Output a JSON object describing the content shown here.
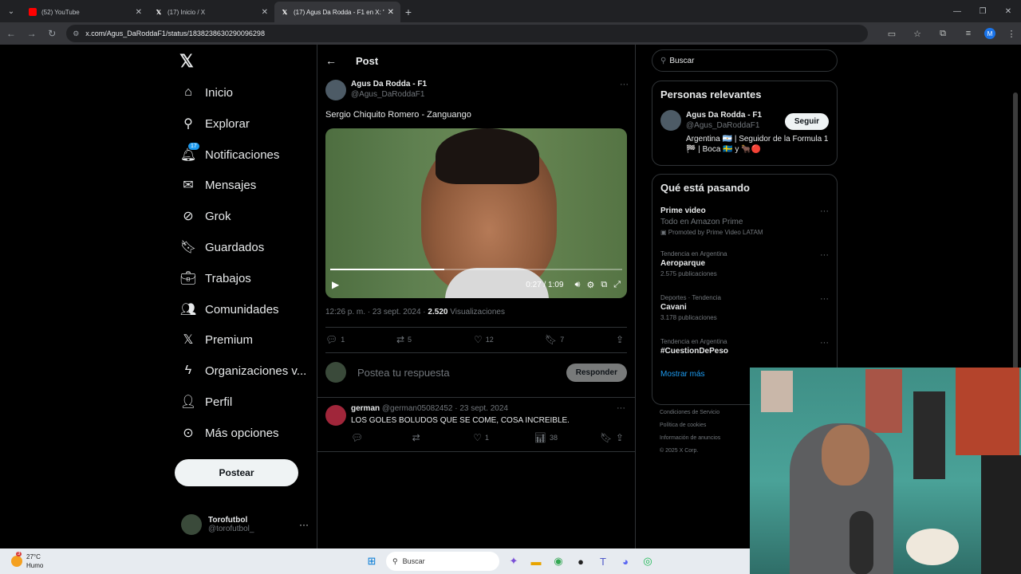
{
  "browser": {
    "tabs": [
      {
        "title": "(52) YouTube",
        "favicon": "youtube-icon"
      },
      {
        "title": "(17) Inicio / X",
        "favicon": "x-icon"
      },
      {
        "title": "(17) Agus Da Rodda - F1 en X: \"S",
        "favicon": "x-icon",
        "active": true
      }
    ],
    "url": "x.com/Agus_DaRoddaF1/status/1838238630290096298",
    "profile_initial": "M"
  },
  "sidebar": {
    "items": [
      {
        "label": "Inicio",
        "icon": "home-icon"
      },
      {
        "label": "Explorar",
        "icon": "search-icon"
      },
      {
        "label": "Notificaciones",
        "icon": "bell-icon",
        "badge": "17"
      },
      {
        "label": "Mensajes",
        "icon": "mail-icon"
      },
      {
        "label": "Grok",
        "icon": "grok-icon"
      },
      {
        "label": "Guardados",
        "icon": "bookmark-icon"
      },
      {
        "label": "Trabajos",
        "icon": "briefcase-icon"
      },
      {
        "label": "Comunidades",
        "icon": "people-icon"
      },
      {
        "label": "Premium",
        "icon": "x-icon"
      },
      {
        "label": "Organizaciones v...",
        "icon": "lightning-icon"
      },
      {
        "label": "Perfil",
        "icon": "person-icon"
      },
      {
        "label": "Más opciones",
        "icon": "more-icon"
      }
    ],
    "post_button": "Postear",
    "account": {
      "name": "Torofutbol",
      "handle": "@torofutbol_"
    }
  },
  "main": {
    "title": "Post",
    "author": {
      "name": "Agus Da Rodda - F1",
      "handle": "@Agus_DaRoddaF1"
    },
    "text": "Sergio Chiquito Romero - Zanguango",
    "video": {
      "time": "0:27 / 1:09",
      "progress": 0.39
    },
    "timestamp": "12:26 p. m. · 23 sept. 2024 · ",
    "views_count": "2.520",
    "views_label": " Visualizaciones",
    "stats": {
      "replies": "1",
      "reposts": "5",
      "likes": "12",
      "bookmarks": "7"
    },
    "reply_placeholder": "Postea tu respuesta",
    "reply_button": "Responder",
    "comment": {
      "name": "german",
      "meta": " @german05082452 · 23 sept. 2024",
      "text": "LOS GOLES BOLUDOS QUE SE COME, COSA INCREIBLE.",
      "likes": "1",
      "views": "38"
    }
  },
  "right": {
    "search_placeholder": "Buscar",
    "relevant": {
      "title": "Personas relevantes",
      "name": "Agus Da Rodda - F1",
      "handle": "@Agus_DaRoddaF1",
      "follow": "Seguir",
      "bio": "Argentina 🇦🇷 | Seguidor de la Formula 1 🏁 | Boca 🇸🇪 y 🐂🔴"
    },
    "trends": {
      "title": "Qué está pasando",
      "items": [
        {
          "topic": "Prime video",
          "sub": "Todo en Amazon Prime",
          "promo": "Promoted by Prime Video LATAM"
        },
        {
          "category": "Tendencia en Argentina",
          "topic": "Aeroparque",
          "count": "2.575 publicaciones"
        },
        {
          "category": "Deportes · Tendencia",
          "topic": "Cavani",
          "count": "3.178 publicaciones"
        },
        {
          "category": "Tendencia en Argentina",
          "topic": "#CuestionDePeso"
        }
      ],
      "more": "Mostrar más"
    },
    "footer": [
      "Condiciones de Servicio",
      "Política de cookies",
      "Información de anuncios",
      "© 2025 X Corp."
    ]
  },
  "taskbar": {
    "weather_temp": "27°C",
    "weather_desc": "Humo",
    "weather_badge": "3",
    "search": "Buscar"
  }
}
